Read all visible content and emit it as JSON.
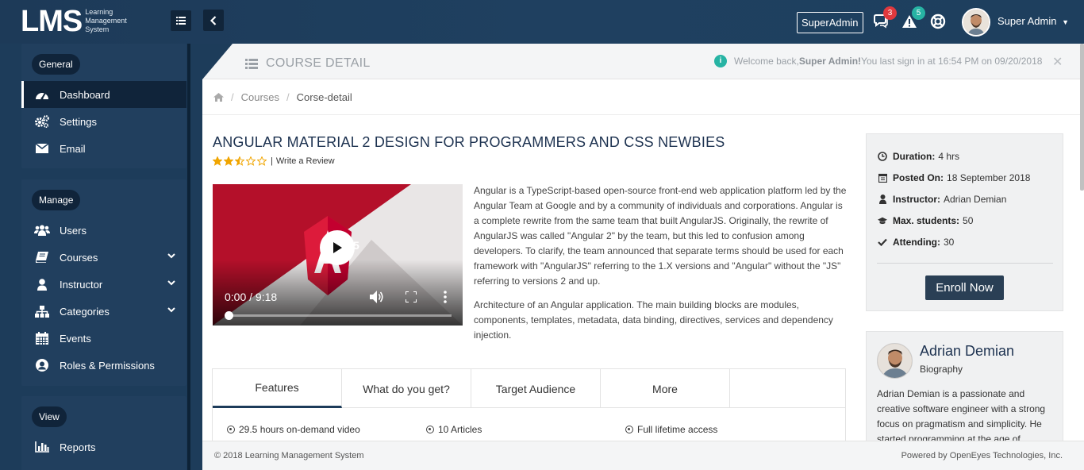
{
  "header": {
    "logo_big": "LMS",
    "logo_line1": "Learning",
    "logo_line2": "Management",
    "logo_line3": "System",
    "superadmin_badge": "SuperAdmin",
    "messages_count": "3",
    "alerts_count": "5",
    "user_name": "Super Admin",
    "colors": {
      "bar": "#1d3a58",
      "messages_badge": "#e0393e",
      "alerts_badge": "#27b4a4"
    }
  },
  "sidebar": {
    "groups": [
      {
        "title": "General",
        "items": [
          {
            "label": "Dashboard",
            "icon": "dashboard-icon",
            "active": true
          },
          {
            "label": "Settings",
            "icon": "gears-icon"
          },
          {
            "label": "Email",
            "icon": "envelope-icon"
          }
        ]
      },
      {
        "title": "Manage",
        "items": [
          {
            "label": "Users",
            "icon": "users-icon"
          },
          {
            "label": "Courses",
            "icon": "book-icon",
            "expandable": true
          },
          {
            "label": "Instructor",
            "icon": "user-icon",
            "expandable": true
          },
          {
            "label": "Categories",
            "icon": "sitemap-icon",
            "expandable": true
          },
          {
            "label": "Events",
            "icon": "calendar-icon"
          },
          {
            "label": "Roles & Permissions",
            "icon": "user-circle-icon"
          }
        ]
      },
      {
        "title": "View",
        "items": [
          {
            "label": "Reports",
            "icon": "bar-chart-icon"
          }
        ]
      }
    ]
  },
  "page": {
    "title": "COURSE DETAIL",
    "welcome_prefix": "Welcome back,",
    "welcome_user": "Super Admin!",
    "welcome_suffix": "You last sign in at 16:54 PM on 09/20/2018",
    "breadcrumb": [
      "Courses",
      "Corse-detail"
    ]
  },
  "course": {
    "title": "ANGULAR MATERIAL 2 DESIGN FOR PROGRAMMERS AND CSS NEWBIES",
    "rating": 2.5,
    "rating_max": 5,
    "review_link": "Write a Review",
    "video_time": "0:00 / 9:18",
    "video_progress": 0,
    "description_1": "Angular is a TypeScript-based open-source front-end web application platform led by the Angular Team at Google and by a community of individuals and corporations. Angular is a complete rewrite from the same team that built AngularJS. Originally, the rewrite of AngularJS was called \"Angular 2\" by the team, but this led to confusion among developers. To clarify, the team announced that separate terms should be used for each framework with \"AngularJS\" referring to the 1.X versions and \"Angular\" without the \"JS\" referring to versions 2 and up.",
    "description_2": "Architecture of an Angular application. The main building blocks are modules, components, templates, metadata, data binding, directives, services and dependency injection.",
    "tabs": [
      "Features",
      "What do you get?",
      "Target Audience",
      "More"
    ],
    "features": [
      "29.5 hours on-demand video",
      "10 Articles",
      "Full lifetime access"
    ]
  },
  "info": {
    "duration_label": "Duration:",
    "duration": "4 hrs",
    "posted_label": "Posted On:",
    "posted": "18 September 2018",
    "instructor_label": "Instructor:",
    "instructor": "Adrian Demian",
    "max_label": "Max. students:",
    "max": "50",
    "attending_label": "Attending:",
    "attending": "30",
    "enroll_button": "Enroll Now"
  },
  "bio": {
    "name": "Adrian Demian",
    "subtitle": "Biography",
    "text": "Adrian Demian is a passionate and creative software engineer with a strong focus on pragmatism and simplicity. He started programming at the age of"
  },
  "footer": {
    "copyright": "© 2018 Learning Management System",
    "powered": "Powered by OpenEyes Technologies, Inc."
  }
}
